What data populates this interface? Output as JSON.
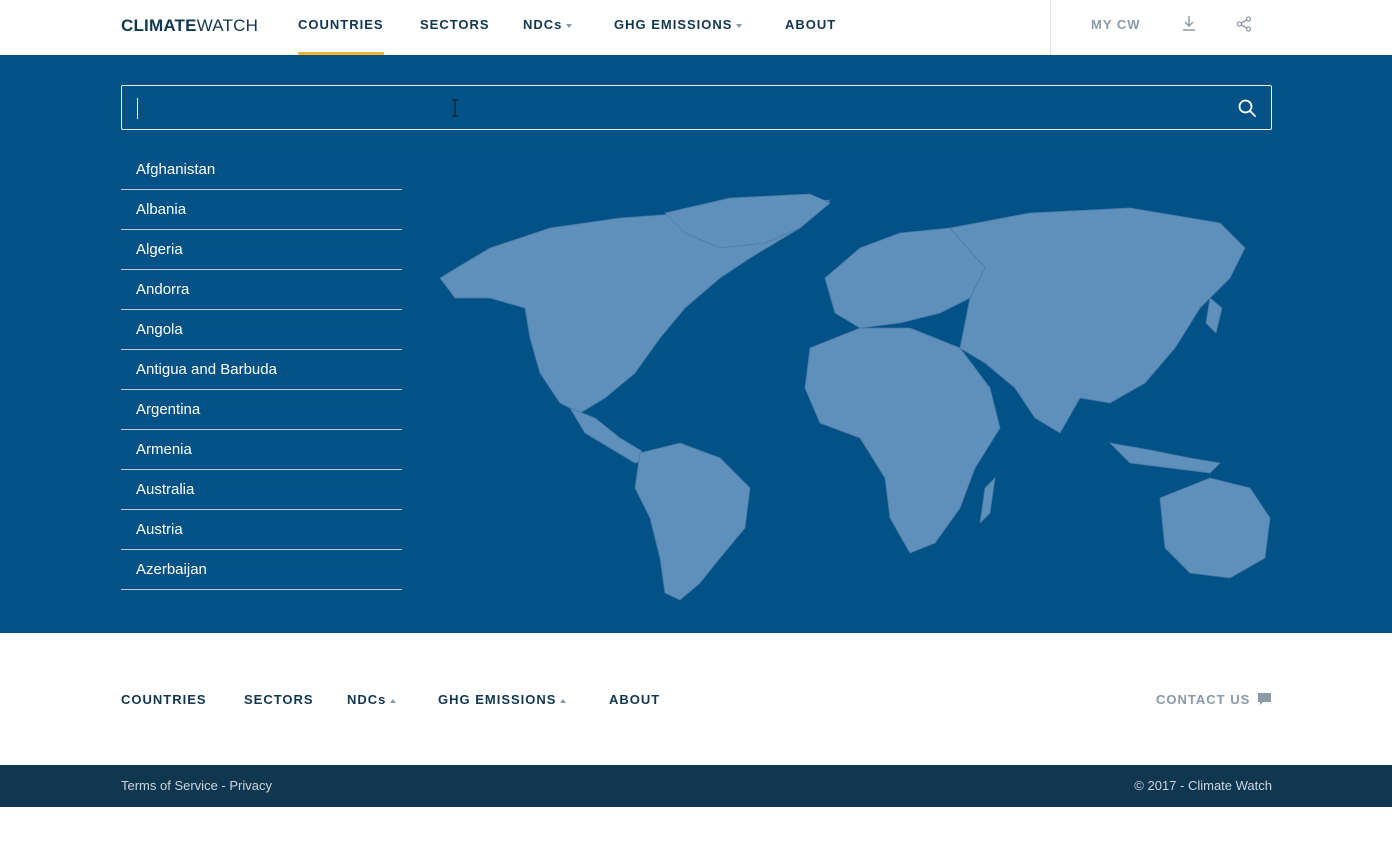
{
  "header": {
    "logo_bold": "CLIMATE",
    "logo_light": "WATCH",
    "nav": [
      {
        "label": "COUNTRIES",
        "active": true
      },
      {
        "label": "SECTORS"
      },
      {
        "label": "NDCs",
        "dropdown": true
      },
      {
        "label": "GHG EMISSIONS",
        "dropdown": true
      },
      {
        "label": "ABOUT"
      }
    ],
    "my_cw": "MY CW",
    "icons": [
      "download-icon",
      "share-icon"
    ]
  },
  "search": {
    "value": "",
    "placeholder": ""
  },
  "countries": [
    "Afghanistan",
    "Albania",
    "Algeria",
    "Andorra",
    "Angola",
    "Antigua and Barbuda",
    "Argentina",
    "Armenia",
    "Australia",
    "Austria",
    "Azerbaijan"
  ],
  "footer": {
    "nav": [
      "COUNTRIES",
      "SECTORS",
      "NDCs",
      "GHG EMISSIONS",
      "ABOUT"
    ],
    "contact": "CONTACT US",
    "terms": "Terms of Service",
    "separator": " - ",
    "privacy": "Privacy",
    "copyright": "© 2017 - Climate Watch"
  },
  "colors": {
    "accent": "#f5b335",
    "hero_bg": "#035287",
    "land": "#5f8fbb",
    "footer_bg": "#113750",
    "text_dark": "#113750"
  }
}
